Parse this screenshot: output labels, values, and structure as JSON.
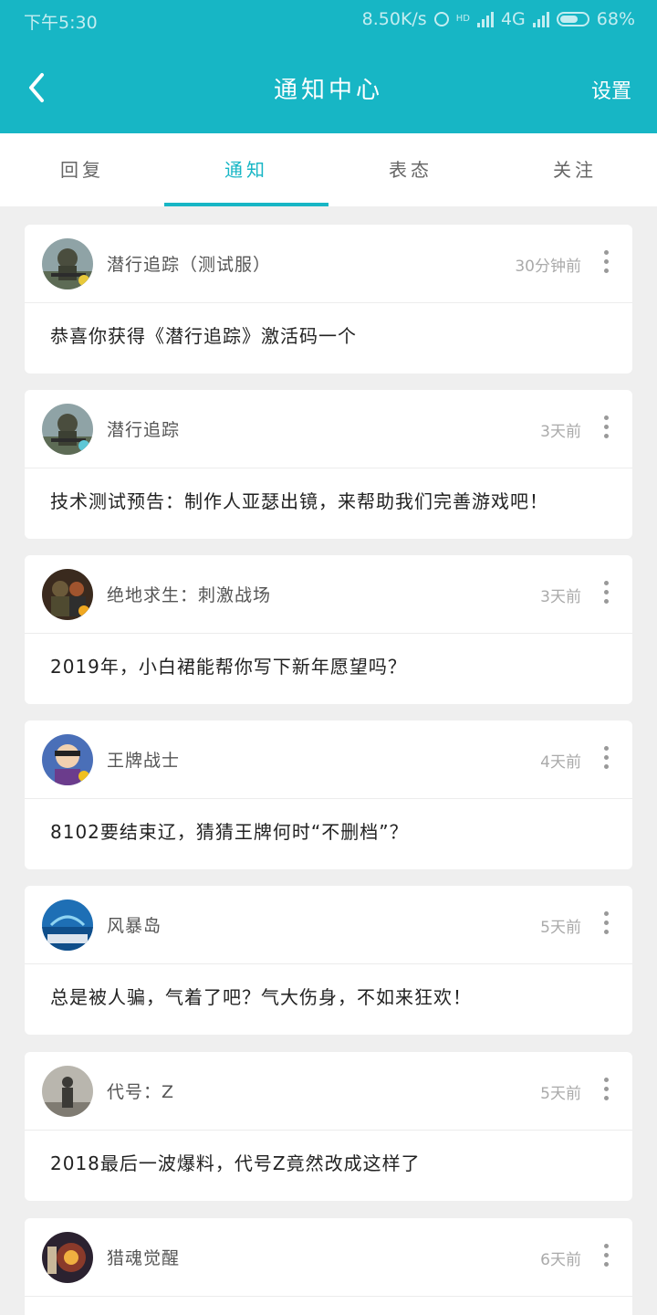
{
  "status_bar": {
    "time": "下午5:30",
    "speed": "8.50K/s",
    "hd": "HD",
    "network": "4G",
    "battery": "68%"
  },
  "header": {
    "title": "通知中心",
    "settings_label": "设置"
  },
  "tabs": [
    {
      "label": "回复"
    },
    {
      "label": "通知"
    },
    {
      "label": "表态"
    },
    {
      "label": "关注"
    }
  ],
  "active_tab": "通知",
  "notifications": [
    {
      "name": "潜行追踪（测试服）",
      "time": "30分钟前",
      "message": "恭喜你获得《潜行追踪》激活码一个",
      "avatar_icon": "soldier-avatar-icon"
    },
    {
      "name": "潜行追踪",
      "time": "3天前",
      "message": "技术测试预告：制作人亚瑟出镜，来帮助我们完善游戏吧！",
      "avatar_icon": "soldier-avatar-icon"
    },
    {
      "name": "绝地求生：刺激战场",
      "time": "3天前",
      "message": "2019年，小白裙能帮你写下新年愿望吗？",
      "avatar_icon": "pubg-avatar-icon"
    },
    {
      "name": "王牌战士",
      "time": "4天前",
      "message": "8102要结束辽，猜猜王牌何时“不删档”？",
      "avatar_icon": "ace-avatar-icon"
    },
    {
      "name": "风暴岛",
      "time": "5天前",
      "message": "总是被人骗，气着了吧？气大伤身，不如来狂欢！",
      "avatar_icon": "storm-island-avatar-icon"
    },
    {
      "name": "代号：Z",
      "time": "5天前",
      "message": "2018最后一波爆料，代号Z竟然改成这样了",
      "avatar_icon": "codename-z-avatar-icon"
    },
    {
      "name": "猎魂觉醒",
      "time": "6天前",
      "message": "",
      "avatar_icon": "hunter-avatar-icon"
    }
  ],
  "colors": {
    "accent": "#17b6c5",
    "background": "#efefef"
  }
}
